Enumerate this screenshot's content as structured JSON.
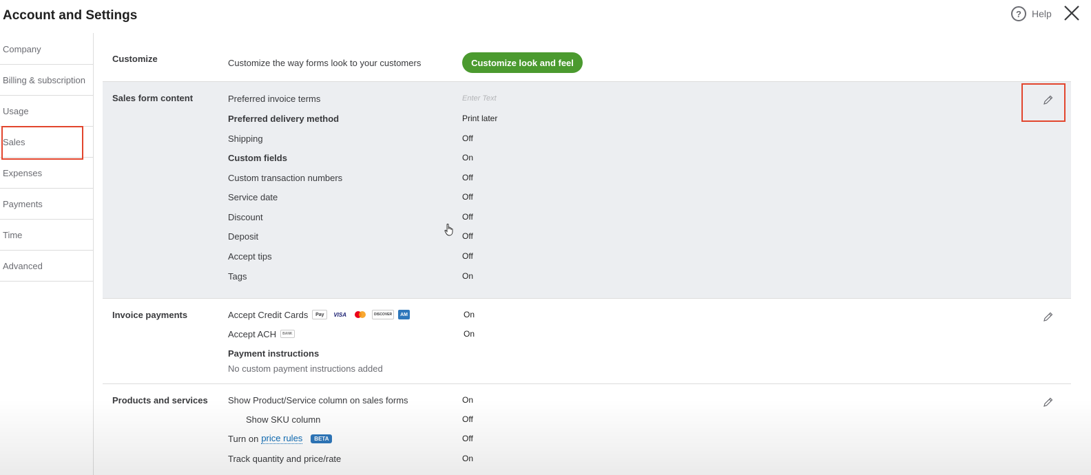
{
  "header": {
    "title": "Account and Settings",
    "help_label": "Help",
    "help_icon_glyph": "?"
  },
  "sidebar": {
    "items": [
      {
        "label": "Company"
      },
      {
        "label": "Billing & subscription"
      },
      {
        "label": "Usage"
      },
      {
        "label": "Sales"
      },
      {
        "label": "Expenses"
      },
      {
        "label": "Payments"
      },
      {
        "label": "Time"
      },
      {
        "label": "Advanced"
      }
    ]
  },
  "customize": {
    "label": "Customize",
    "description": "Customize the way forms look to your customers",
    "button_label": "Customize look and feel"
  },
  "sales_form": {
    "label": "Sales form content",
    "rows": [
      {
        "name": "Preferred invoice terms",
        "value": "",
        "placeholder": "Enter Text"
      },
      {
        "name": "Preferred delivery method",
        "value": "Print later"
      },
      {
        "name": "Shipping",
        "value": "Off"
      },
      {
        "name": "Custom fields",
        "value": "On"
      },
      {
        "name": "Custom transaction numbers",
        "value": "Off"
      },
      {
        "name": "Service date",
        "value": "Off"
      },
      {
        "name": "Discount",
        "value": "Off"
      },
      {
        "name": "Deposit",
        "value": "Off"
      },
      {
        "name": "Accept tips",
        "value": "Off"
      },
      {
        "name": "Tags",
        "value": "On"
      }
    ]
  },
  "invoice_payments": {
    "label": "Invoice payments",
    "credit_cards": {
      "name": "Accept Credit Cards",
      "value": "On",
      "card_labels": [
        "Pay",
        "VISA",
        "DISCOVER",
        "AM"
      ]
    },
    "ach": {
      "name": "Accept ACH",
      "value": "On",
      "bank_label": "BANK"
    },
    "instructions_title": "Payment instructions",
    "instructions_text": "No custom payment instructions added"
  },
  "products": {
    "label": "Products and services",
    "rows": [
      {
        "name": "Show Product/Service column on sales forms",
        "value": "On"
      },
      {
        "name": "Show SKU column",
        "value": "Off"
      },
      {
        "name_prefix": "Turn on",
        "link": "price rules",
        "badge": "BETA",
        "value": "Off"
      },
      {
        "name": "Track quantity and price/rate",
        "value": "On"
      }
    ]
  },
  "colors": {
    "accent_green": "#4b9a2f",
    "highlight_red": "#e2452d",
    "link_blue": "#0d6bb5",
    "section_shade": "#eceef1"
  }
}
